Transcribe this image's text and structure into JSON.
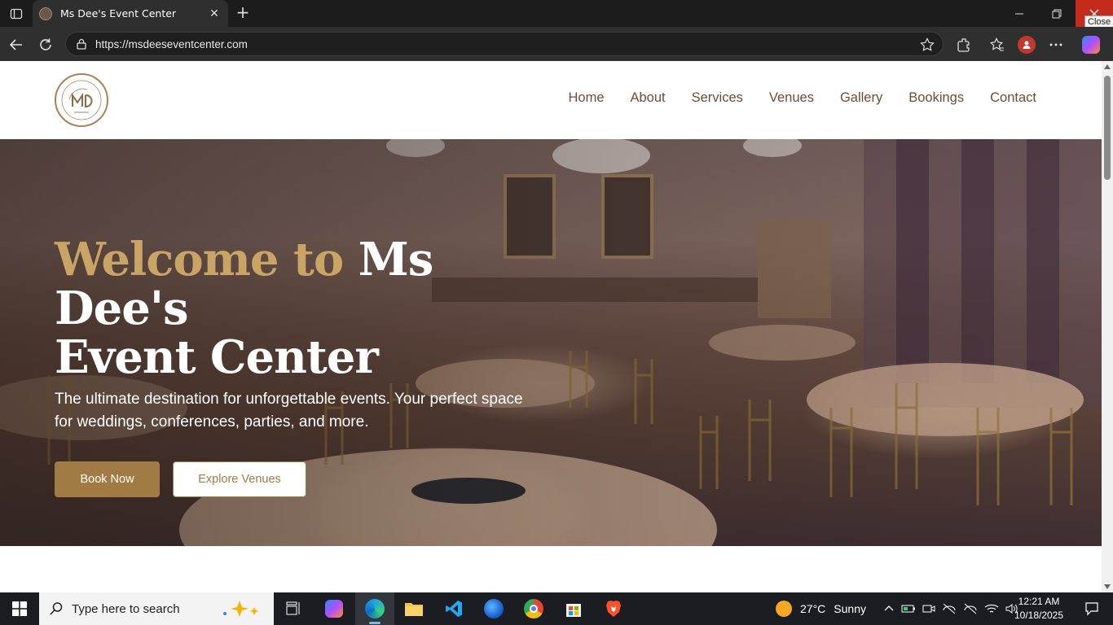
{
  "browser": {
    "tab_title": "Ms Dee's Event Center",
    "url": "https://msdeeseventcenter.com",
    "close_tooltip": "Close"
  },
  "site": {
    "nav": [
      "Home",
      "About",
      "Services",
      "Venues",
      "Gallery",
      "Bookings",
      "Contact"
    ],
    "hero": {
      "title_accent": "Welcome to",
      "title_rest": "Ms Dee's",
      "title_line2": "Event Center",
      "subtitle": "The ultimate destination for unforgettable events. Your perfect space for weddings, conferences, parties, and more.",
      "primary_button": "Book Now",
      "secondary_button": "Explore Venues"
    },
    "colors": {
      "accent": "#c9a464",
      "brand_button": "#a27b44",
      "nav_text": "#6b4e31"
    }
  },
  "taskbar": {
    "search_placeholder": "Type here to search",
    "weather_temp": "27°C",
    "weather_desc": "Sunny",
    "time": "12:21 AM",
    "date": "10/18/2025"
  }
}
